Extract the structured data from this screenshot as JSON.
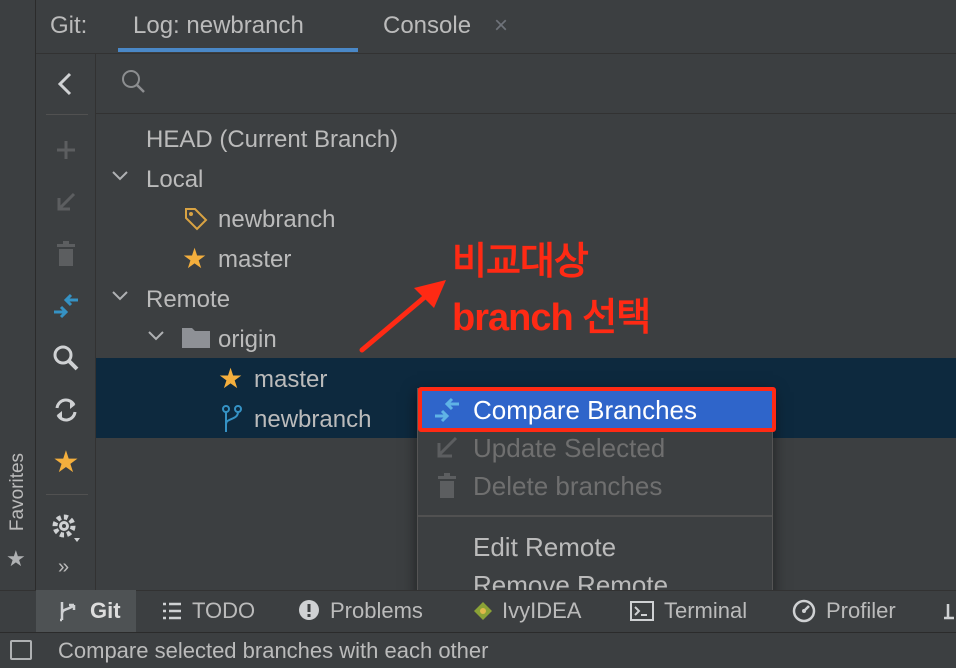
{
  "header": {
    "panel_label": "Git:",
    "tabs": [
      {
        "label": "Log: newbranch",
        "active": true
      },
      {
        "label": "Console",
        "closable": true,
        "close_glyph": "×"
      }
    ]
  },
  "sidebar": {
    "favorites_label": "Favorites",
    "more_glyph": "»"
  },
  "toolbar": {
    "icons": [
      "back-arrow-icon",
      "add-icon",
      "update-icon",
      "delete-icon",
      "compare-branches-icon",
      "search-icon",
      "refresh-icon",
      "favorite-star-icon",
      "settings-icon"
    ]
  },
  "tree": {
    "head": "HEAD (Current Branch)",
    "local": {
      "label": "Local",
      "branches": [
        {
          "name": "newbranch",
          "icon": "tag-icon"
        },
        {
          "name": "master",
          "icon": "star-icon"
        }
      ]
    },
    "remote": {
      "label": "Remote",
      "origin": {
        "label": "origin",
        "branches": [
          {
            "name": "master",
            "icon": "star-icon"
          },
          {
            "name": "newbranch",
            "icon": "branch-icon"
          }
        ]
      }
    }
  },
  "annotation": {
    "line1": "비교대상",
    "line2": "branch 선택"
  },
  "context_menu": {
    "items": [
      {
        "label": "Compare Branches",
        "enabled": true,
        "highlighted": true
      },
      {
        "label": "Update Selected",
        "enabled": false
      },
      {
        "label": "Delete branches",
        "enabled": false
      },
      {
        "label": "Edit Remote",
        "enabled": true
      },
      {
        "label": "Remove Remote",
        "enabled": true
      }
    ]
  },
  "bottom_bar": {
    "items": [
      {
        "label": "Git",
        "active": true
      },
      {
        "label": "TODO"
      },
      {
        "label": "Problems"
      },
      {
        "label": "IvyIDEA"
      },
      {
        "label": "Terminal"
      },
      {
        "label": "Profiler"
      }
    ]
  },
  "status_bar": {
    "text": "Compare selected branches with each other"
  },
  "colors": {
    "background": "#3c3f41",
    "selection": "#0d293e",
    "menu_highlight": "#2f65ca",
    "annotation_red": "#ff2a14",
    "star_yellow": "#f4af3d",
    "accent_blue": "#3592c4"
  }
}
